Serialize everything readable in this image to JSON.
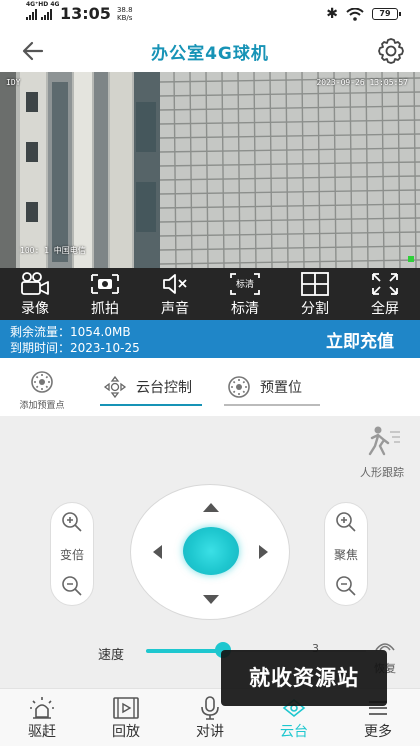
{
  "status_bar": {
    "network": "4G⁺HD 4G",
    "time": "13:05",
    "speed_value": "38.8",
    "speed_unit": "KB/s",
    "battery": "79"
  },
  "header": {
    "title": "办公室4G球机",
    "back_icon": "arrow-left-icon",
    "settings_icon": "gear-icon"
  },
  "video": {
    "timestamp": "2023-09-26  13:05:57",
    "channel_label": "100: 1 中国电信",
    "corner_label": "IDY"
  },
  "toolbar": {
    "items": [
      {
        "label": "录像",
        "icon": "video-camera-icon"
      },
      {
        "label": "抓拍",
        "icon": "camera-icon"
      },
      {
        "label": "声音",
        "icon": "speaker-mute-icon"
      },
      {
        "label": "标清",
        "icon": "quality-sd-icon",
        "badge": "标清"
      },
      {
        "label": "分割",
        "icon": "grid-split-icon"
      },
      {
        "label": "全屏",
        "icon": "fullscreen-icon"
      }
    ]
  },
  "data_plan": {
    "remaining_label": "剩余流量：1054.0MB",
    "expiry_label": "到期时间：2023-10-25",
    "recharge_button": "立即充值"
  },
  "tabs": {
    "add_preset": "添加预置点",
    "ptz_control": "云台控制",
    "preset": "预置位"
  },
  "control": {
    "human_tracking": "人形跟踪",
    "zoom_label": "变倍",
    "focus_label": "聚焦",
    "speed_label": "速度",
    "speed_value": 0.35,
    "speed_max_hint": "3",
    "restore_label": "恢复"
  },
  "watermark": "就收资源站",
  "bottom_nav": {
    "items": [
      {
        "label": "驱赶",
        "icon": "alarm-light-icon"
      },
      {
        "label": "回放",
        "icon": "playback-film-icon"
      },
      {
        "label": "对讲",
        "icon": "microphone-icon"
      },
      {
        "label": "云台",
        "icon": "ptz-icon",
        "active": true
      },
      {
        "label": "更多",
        "icon": "more-menu-icon"
      }
    ]
  },
  "colors": {
    "accent": "#1793b6",
    "banner": "#1f86c8",
    "joystick": "#1ec7cf",
    "toolbar": "#262626"
  }
}
